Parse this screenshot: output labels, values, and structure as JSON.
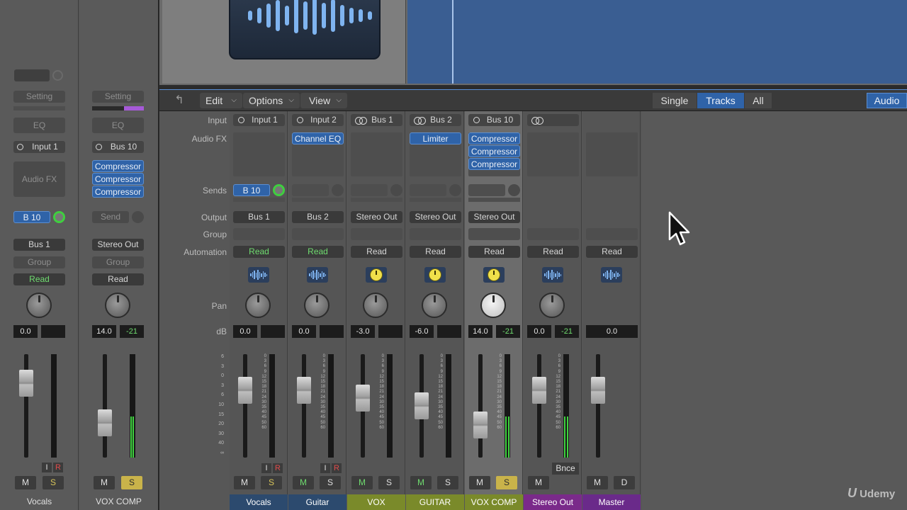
{
  "header": {
    "back_label": "↰",
    "menus": [
      {
        "label": "Edit"
      },
      {
        "label": "Options"
      },
      {
        "label": "View"
      }
    ],
    "view_modes": [
      {
        "label": "Single",
        "active": false
      },
      {
        "label": "Tracks",
        "active": true
      },
      {
        "label": "All",
        "active": false
      }
    ],
    "audio_label": "Audio"
  },
  "row_labels": {
    "input": "Input",
    "audio_fx": "Audio FX",
    "sends": "Sends",
    "output": "Output",
    "group": "Group",
    "automation": "Automation",
    "pan": "Pan",
    "db": "dB"
  },
  "inspector": {
    "left": {
      "setting": "Setting",
      "eq": "EQ",
      "input": "Input 1",
      "audio_fx": "Audio FX",
      "send": "B 10",
      "output": "Bus 1",
      "group": "Group",
      "automation": "Read",
      "vol": "0.0",
      "mute": "M",
      "solo": "S",
      "input_mon": "I",
      "rec": "R",
      "name": "Vocals"
    },
    "right": {
      "setting": "Setting",
      "eq": "EQ",
      "input": "Bus 10",
      "plugins": [
        "Compressor",
        "Compressor",
        "Compressor"
      ],
      "send": "Send",
      "output": "Stereo Out",
      "group": "Group",
      "automation": "Read",
      "vol": "14.0",
      "peak": "-21",
      "mute": "M",
      "solo": "S",
      "name": "VOX COMP"
    }
  },
  "fader_scale": [
    "6",
    "3",
    "0",
    "3",
    "6",
    "10",
    "15",
    "20",
    "30",
    "40",
    "∞"
  ],
  "meter_scale": [
    "0",
    "3",
    "6",
    "9",
    "12",
    "15",
    "18",
    "21",
    "24",
    "30",
    "35",
    "40",
    "45",
    "50",
    "60"
  ],
  "channels": [
    {
      "name": "Vocals",
      "input": "Input 1",
      "input_icon": "mono",
      "plugins": [],
      "send": "B 10",
      "output": "Bus 1",
      "automation": "Read",
      "automation_green": true,
      "icon": "wave",
      "vol": "0.0",
      "peak": "",
      "mute": "M",
      "solo": "S",
      "solo_style": "yellow",
      "has_ir": true,
      "input_mon": "I",
      "rec": "R",
      "name_color": "#2c4a6e",
      "fader": 0.3,
      "meter": 0
    },
    {
      "name": "Guitar",
      "input": "Input 2",
      "input_icon": "mono",
      "plugins": [
        "Channel EQ"
      ],
      "send": "",
      "output": "Bus 2",
      "automation": "Read",
      "automation_green": true,
      "icon": "wave",
      "vol": "0.0",
      "peak": "",
      "mute": "M",
      "solo": "S",
      "solo_style": "plain",
      "mute_style": "green",
      "has_ir": true,
      "input_mon": "I",
      "rec": "R",
      "name_color": "#2c4a6e",
      "fader": 0.3,
      "meter": 0
    },
    {
      "name": "VOX",
      "input": "Bus 1",
      "input_icon": "stereo",
      "plugins": [],
      "send": "",
      "output": "Stereo Out",
      "automation": "Read",
      "automation_green": false,
      "icon": "knob",
      "vol": "-3.0",
      "peak": "",
      "mute": "M",
      "solo": "S",
      "solo_style": "plain",
      "mute_style": "green",
      "has_ir": false,
      "name_color": "#7a8a2a",
      "fader": 0.4,
      "meter": 0
    },
    {
      "name": "GUITAR",
      "input": "Bus 2",
      "input_icon": "stereo",
      "plugins": [
        "Limiter"
      ],
      "send": "",
      "output": "Stereo Out",
      "automation": "Read",
      "automation_green": false,
      "icon": "knob",
      "vol": "-6.0",
      "peak": "",
      "mute": "M",
      "solo": "S",
      "solo_style": "plain",
      "mute_style": "green",
      "has_ir": false,
      "name_color": "#7a8a2a",
      "fader": 0.5,
      "meter": 0
    },
    {
      "name": "VOX COMP",
      "input": "Bus 10",
      "input_icon": "mono",
      "plugins": [
        "Compressor",
        "Compressor",
        "Compressor"
      ],
      "send": "",
      "output": "Stereo Out",
      "automation": "Read",
      "automation_green": false,
      "icon": "knob",
      "vol": "14.0",
      "peak": "-21",
      "mute": "M",
      "solo": "S",
      "solo_style": "on",
      "has_ir": false,
      "name_color": "#7a8a2a",
      "fader": 0.75,
      "meter": 0.4,
      "selected": true
    },
    {
      "name": "Stereo Out",
      "input": "",
      "input_icon": "stereo",
      "plugins": [],
      "send": "",
      "output": "",
      "automation": "Read",
      "automation_green": false,
      "icon": "wave",
      "vol": "0.0",
      "peak": "-21",
      "mute": "M",
      "solo": "",
      "solo_style": "none",
      "bounce": "Bnce",
      "has_ir": false,
      "name_color": "#7a2a8a",
      "fader": 0.3,
      "meter": 0.4
    },
    {
      "name": "Master",
      "input": "",
      "input_icon": "none",
      "plugins": [],
      "send": "",
      "output": "",
      "automation": "Read",
      "automation_green": false,
      "icon": "wave",
      "vol": "0.0",
      "peak": "",
      "mute": "M",
      "solo": "D",
      "solo_style": "plain",
      "has_ir": false,
      "name_color": "#6a2a8a",
      "fader": 0.3,
      "meter": 0,
      "master": true
    }
  ],
  "watermark": "Udemy",
  "colors": {
    "accent_blue": "#2f63a8",
    "green_text": "#6fdc6f",
    "solo_yellow": "#c9b34a",
    "region_blue": "#3a5e92"
  }
}
